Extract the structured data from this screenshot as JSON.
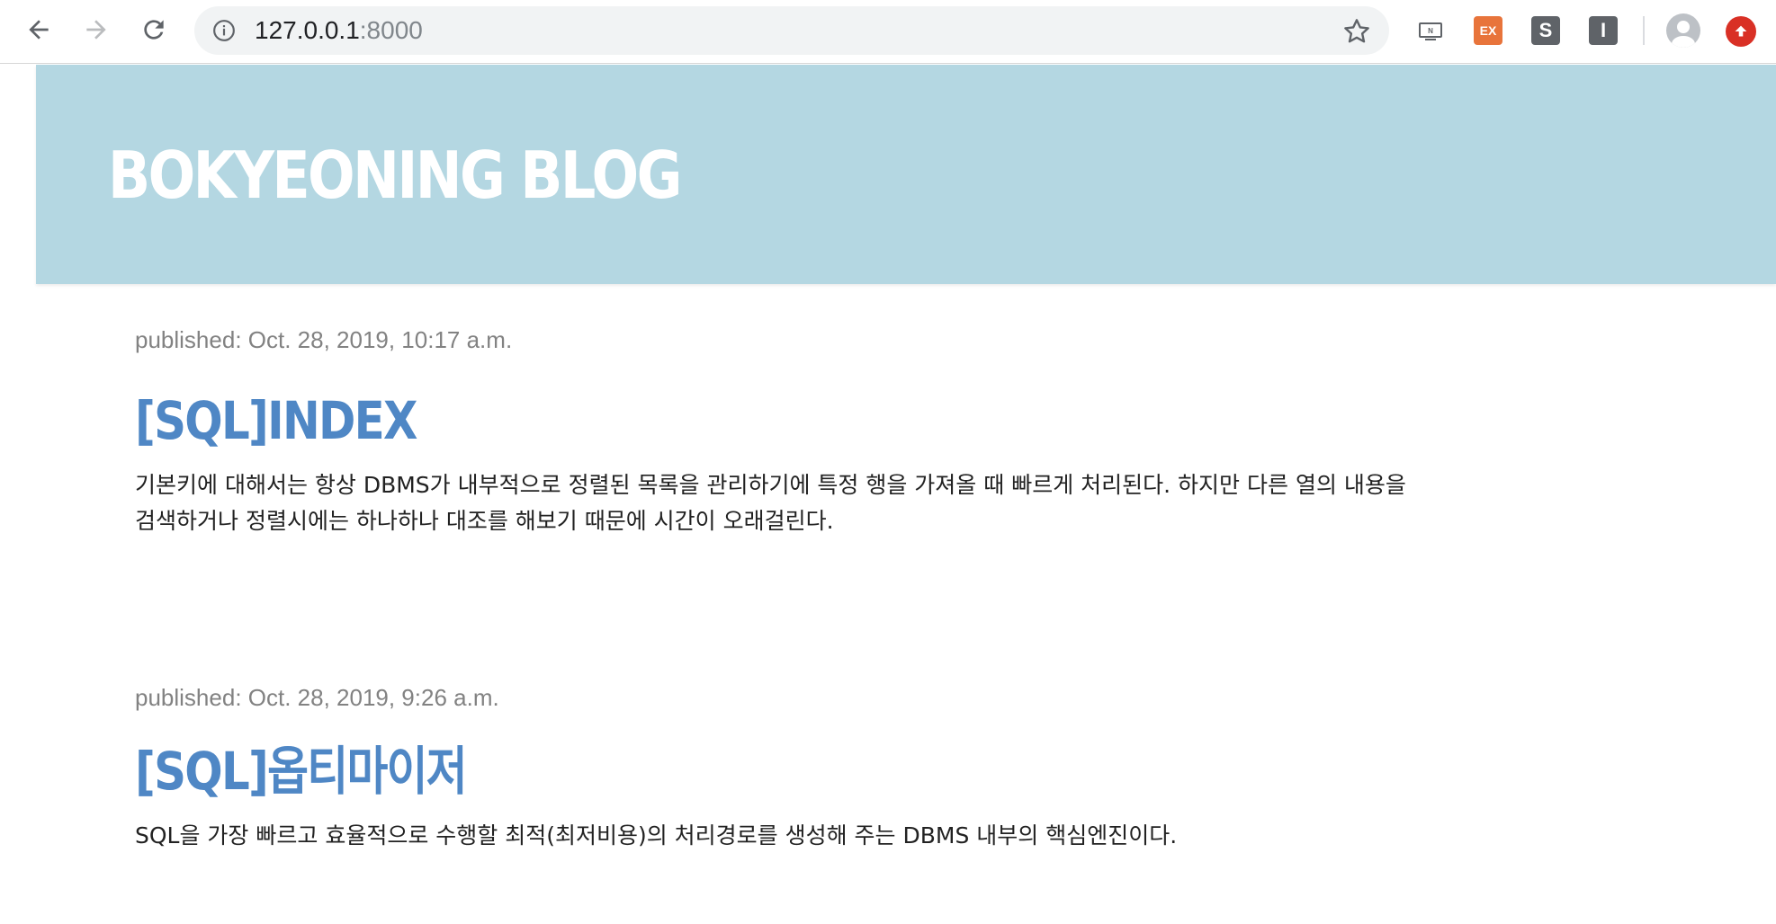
{
  "browser": {
    "url_host": "127.0.0.1",
    "url_port": ":8000",
    "extensions": {
      "ex_label": "EX",
      "s_label": "S",
      "i_label": "I",
      "n_label": "N"
    }
  },
  "site": {
    "title": "BOKYEONING BLOG"
  },
  "posts": [
    {
      "published": "published: Oct. 28, 2019, 10:17 a.m.",
      "title": "[SQL]INDEX",
      "excerpt": "기본키에 대해서는 항상 DBMS가 내부적으로 정렬된 목록을 관리하기에 특정 행을 가져올 때 빠르게 처리된다. 하지만 다른 열의 내용을 검색하거나 정렬시에는 하나하나 대조를 해보기 때문에 시간이 오래걸린다."
    },
    {
      "published": "published: Oct. 28, 2019, 9:26 a.m.",
      "title": "[SQL]옵티마이저",
      "excerpt": "SQL을 가장 빠르고 효율적으로 수행할 최적(최저비용)의 처리경로를 생성해 주는 DBMS 내부의 핵심엔진이다."
    }
  ],
  "colors": {
    "header_band": "#b4d7e2",
    "site_title": "#ffffff",
    "post_title": "#4f87c5",
    "meta": "#828282",
    "excerpt": "#222222"
  }
}
